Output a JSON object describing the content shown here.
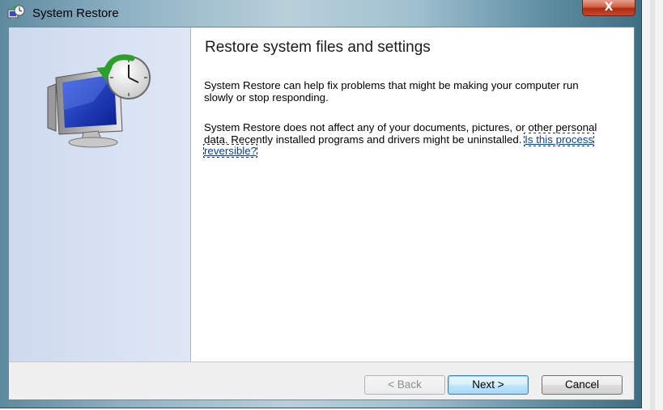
{
  "window": {
    "title": "System Restore",
    "close_glyph": "X",
    "title_icon": "system-restore-icon"
  },
  "side_panel": {
    "illustration": "system-restore-monitor-clock-icon"
  },
  "main": {
    "heading": "Restore system files and settings",
    "paragraph1": "System Restore can help fix problems that might be making your computer run slowly or stop responding.",
    "paragraph2_text": "System Restore does not affect any of your documents, pictures, or other personal data. Recently installed programs and drivers might be uninstalled.",
    "reversible_link": "Is this process reversible?"
  },
  "footer": {
    "back_label": "< Back",
    "back_enabled": false,
    "next_label": "Next >",
    "cancel_label": "Cancel"
  },
  "colors": {
    "link": "#0b3f9c",
    "close_button": "#c8482a",
    "side_panel": "#d9e2f3"
  }
}
